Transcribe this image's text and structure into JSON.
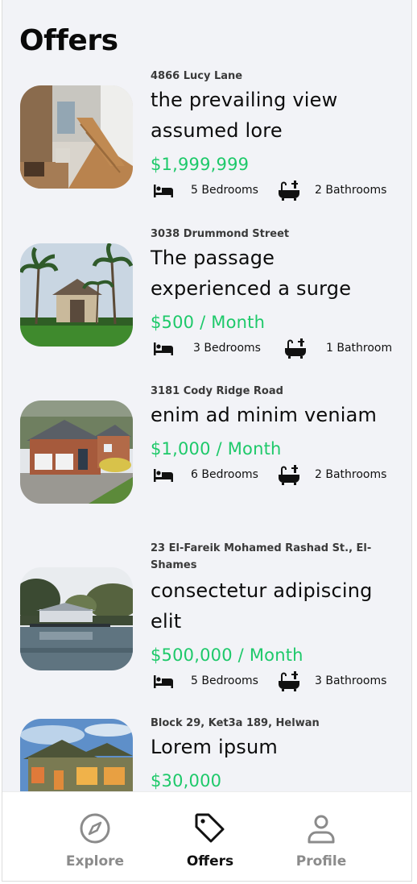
{
  "page": {
    "title": "Offers"
  },
  "listings": [
    {
      "address": "4866 Lucy Lane",
      "title": "the prevailing view assumed lore",
      "price": "$1,999,999",
      "bedrooms": "5 Bedrooms",
      "bathrooms": "2 Bathrooms",
      "image": "interior-staircase-photo"
    },
    {
      "address": "3038 Drummond Street",
      "title": "The passage experienced a surge",
      "price": "$500 / Month",
      "bedrooms": "3 Bedrooms",
      "bathrooms": "1 Bathroom",
      "image": "palm-tree-villa-photo"
    },
    {
      "address": "3181 Cody Ridge Road",
      "title": "enim ad minim veniam",
      "price": "$1,000 / Month",
      "bedrooms": "6 Bedrooms",
      "bathrooms": "2 Bathrooms",
      "image": "brick-house-photo"
    },
    {
      "address": "23 El-Fareik Mohamed Rashad St., El-Shames",
      "title": "consectetur adipiscing elit",
      "price": "$500,000 / Month",
      "bedrooms": "5 Bedrooms",
      "bathrooms": "3 Bathrooms",
      "image": "lake-house-photo"
    },
    {
      "address": "Block 29, Ket3a 189, Helwan",
      "title": "Lorem ipsum",
      "price": "$30,000",
      "bedrooms": "",
      "bathrooms": "",
      "image": "evening-house-photo"
    }
  ],
  "icons": {
    "bedroom": "bed-icon",
    "bathroom": "bathtub-icon"
  },
  "tabbar": {
    "tabs": [
      {
        "label": "Explore",
        "icon": "compass-icon",
        "active": false
      },
      {
        "label": "Offers",
        "icon": "tag-icon",
        "active": true
      },
      {
        "label": "Profile",
        "icon": "user-icon",
        "active": false
      }
    ]
  },
  "colors": {
    "price": "#1ec96a",
    "background": "#f2f3f7",
    "active_tab": "#111111",
    "inactive_tab": "#8b8b8b"
  }
}
